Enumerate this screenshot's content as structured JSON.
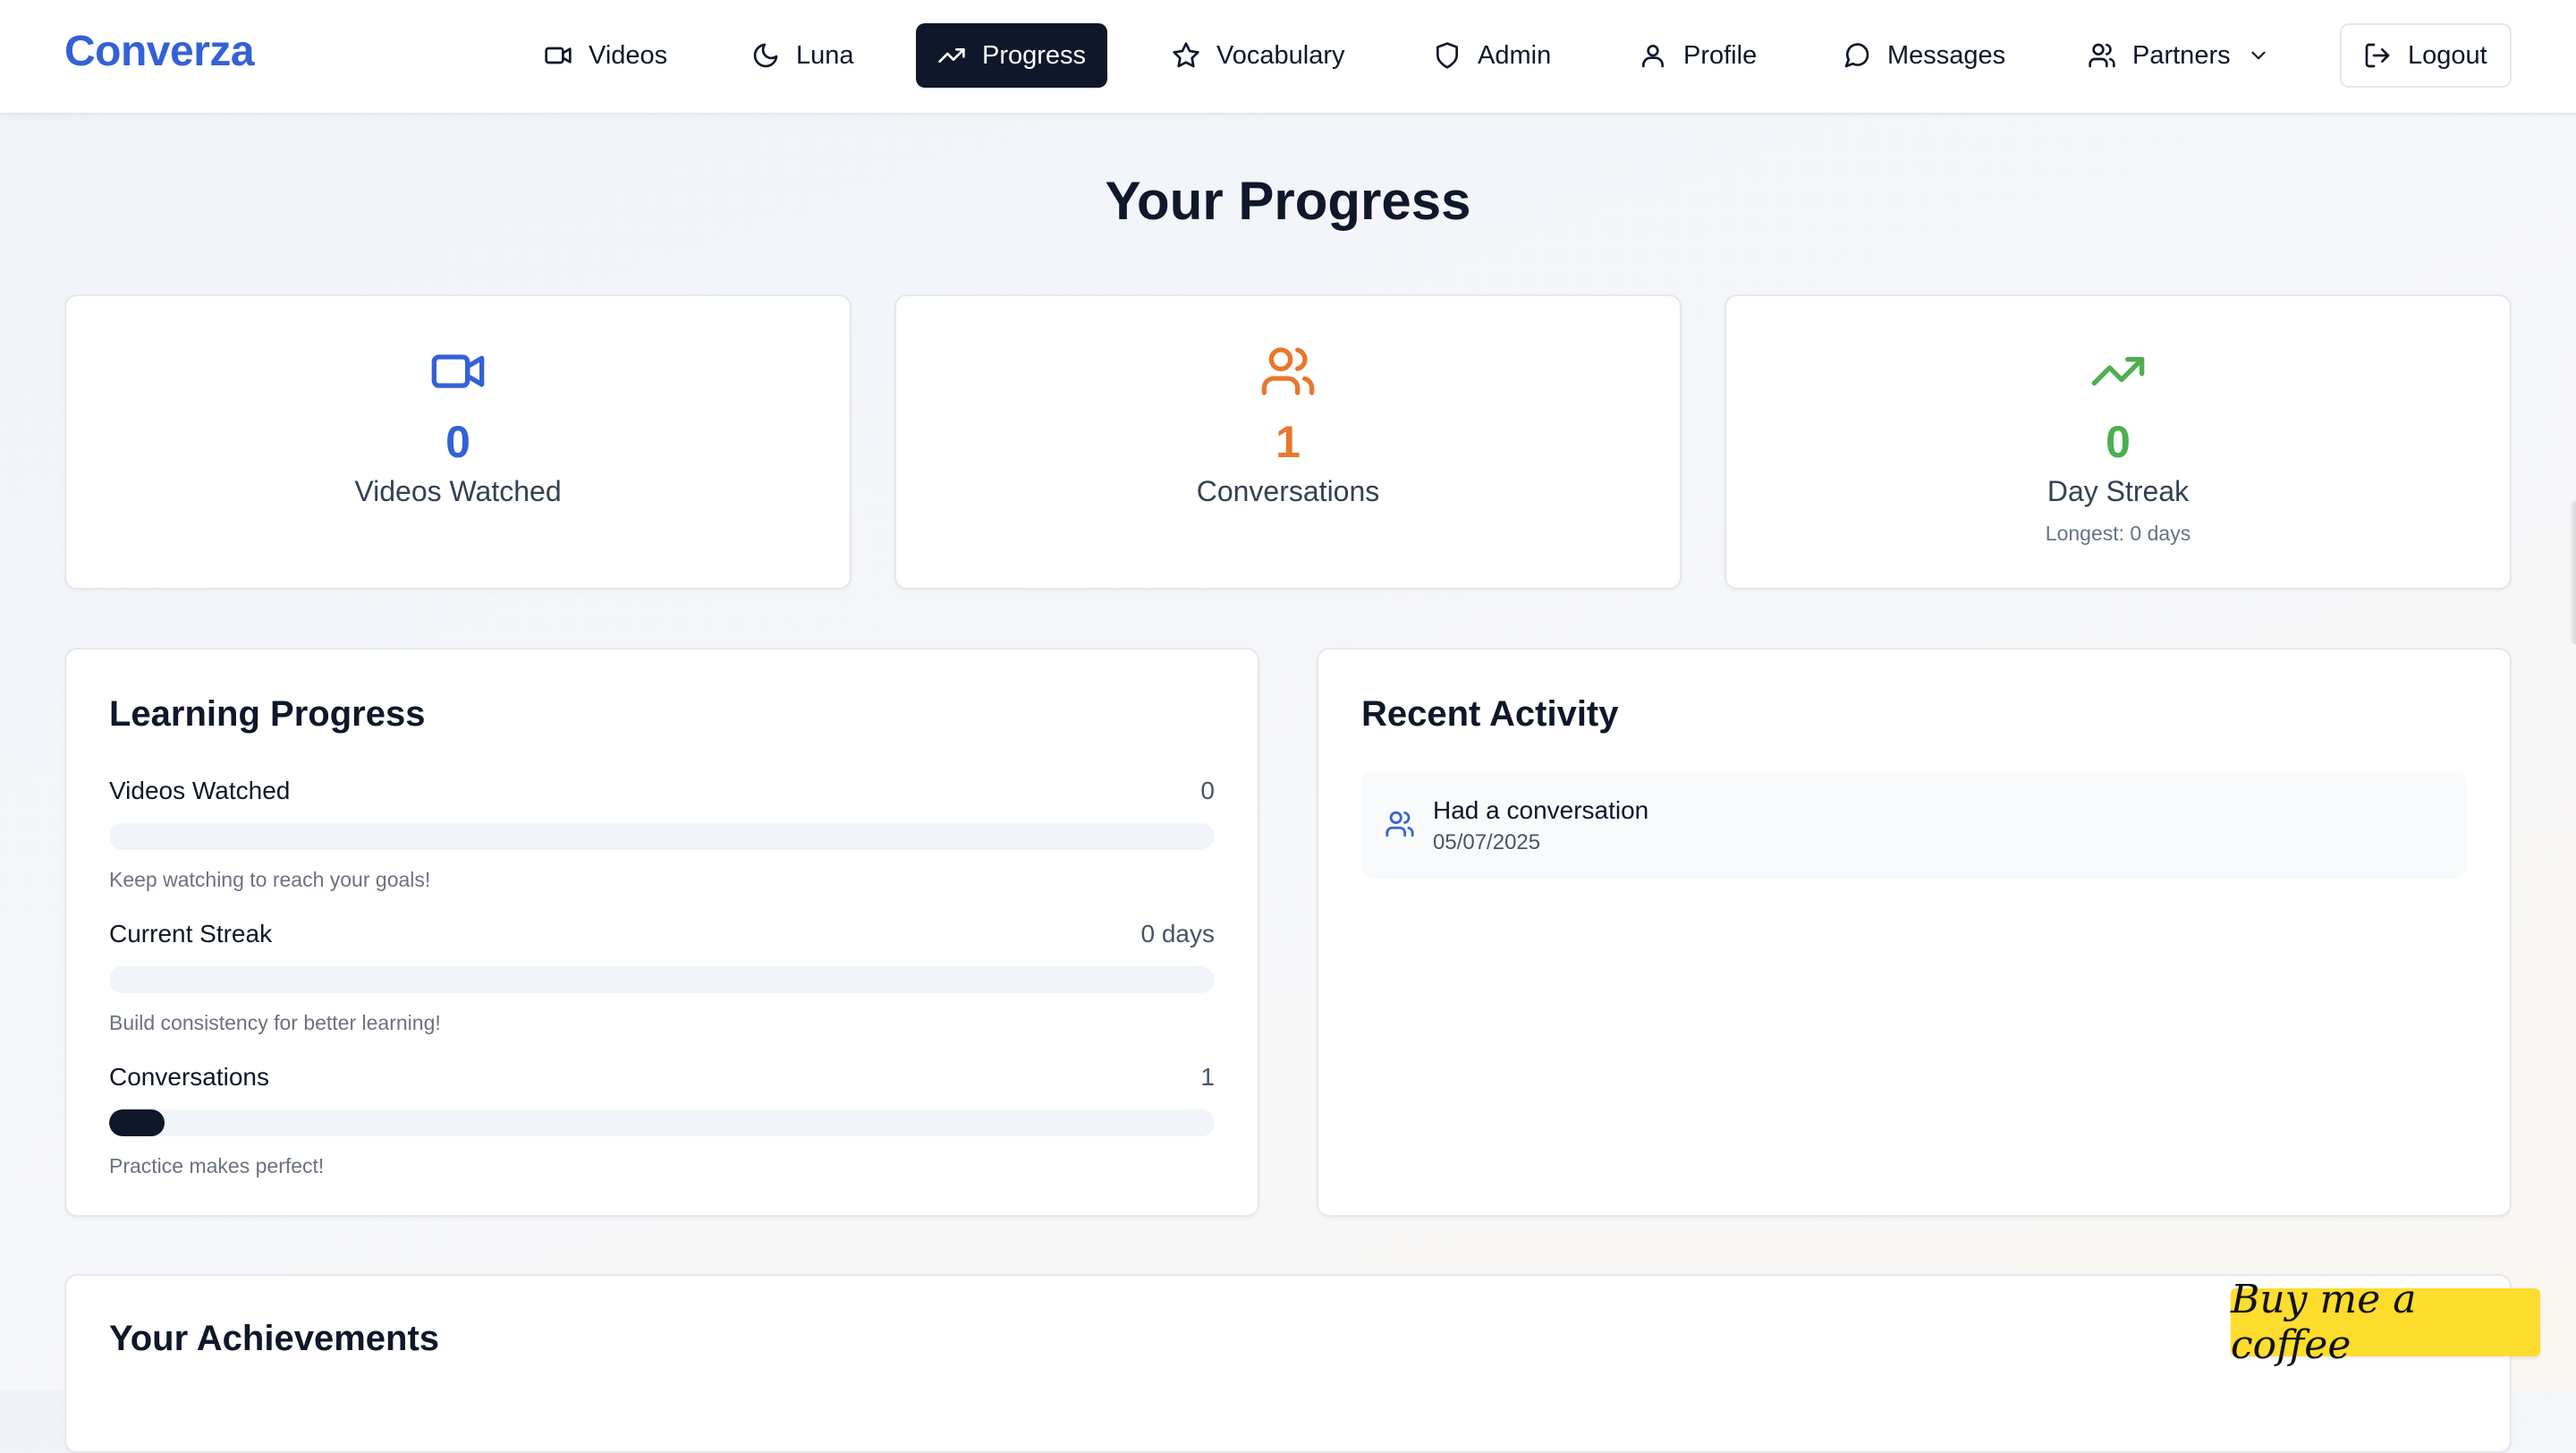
{
  "header": {
    "brand": "Converza",
    "nav": [
      {
        "label": "Videos",
        "icon": "video-icon"
      },
      {
        "label": "Luna",
        "icon": "moon-icon"
      },
      {
        "label": "Progress",
        "icon": "trending-up-icon",
        "active": true
      },
      {
        "label": "Vocabulary",
        "icon": "star-icon"
      },
      {
        "label": "Admin",
        "icon": "shield-icon"
      },
      {
        "label": "Profile",
        "icon": "user-icon"
      },
      {
        "label": "Messages",
        "icon": "message-circle-icon"
      },
      {
        "label": "Partners",
        "icon": "users-icon",
        "dropdown": true
      }
    ],
    "logout": {
      "label": "Logout",
      "icon": "logout-icon"
    }
  },
  "page": {
    "title": "Your Progress"
  },
  "stats": [
    {
      "value": "0",
      "label": "Videos Watched",
      "icon": "video-icon",
      "color": "#3361d6"
    },
    {
      "value": "1",
      "label": "Conversations",
      "icon": "users-icon",
      "color": "#e8772e"
    },
    {
      "value": "0",
      "label": "Day Streak",
      "sublabel": "Longest: 0 days",
      "icon": "trending-up-icon",
      "color": "#4caf50"
    }
  ],
  "learning": {
    "title": "Learning Progress",
    "rows": [
      {
        "name": "Videos Watched",
        "value": "0",
        "hint": "Keep watching to reach your goals!",
        "fill_fraction": 0
      },
      {
        "name": "Current Streak",
        "value": "0 days",
        "hint": "Build consistency for better learning!",
        "fill_fraction": 0
      },
      {
        "name": "Conversations",
        "value": "1",
        "hint": "Practice makes perfect!",
        "fill_fraction": 0.05
      }
    ]
  },
  "activity": {
    "title": "Recent Activity",
    "items": [
      {
        "title": "Had a conversation",
        "date": "05/07/2025",
        "icon": "users-icon"
      }
    ]
  },
  "achievements": {
    "title": "Your Achievements"
  },
  "coffee": {
    "label": "Buy me a coffee"
  },
  "colors": {
    "accent": "#3361d6",
    "dark": "#0f172a",
    "orange": "#e8772e",
    "green": "#4caf50"
  }
}
